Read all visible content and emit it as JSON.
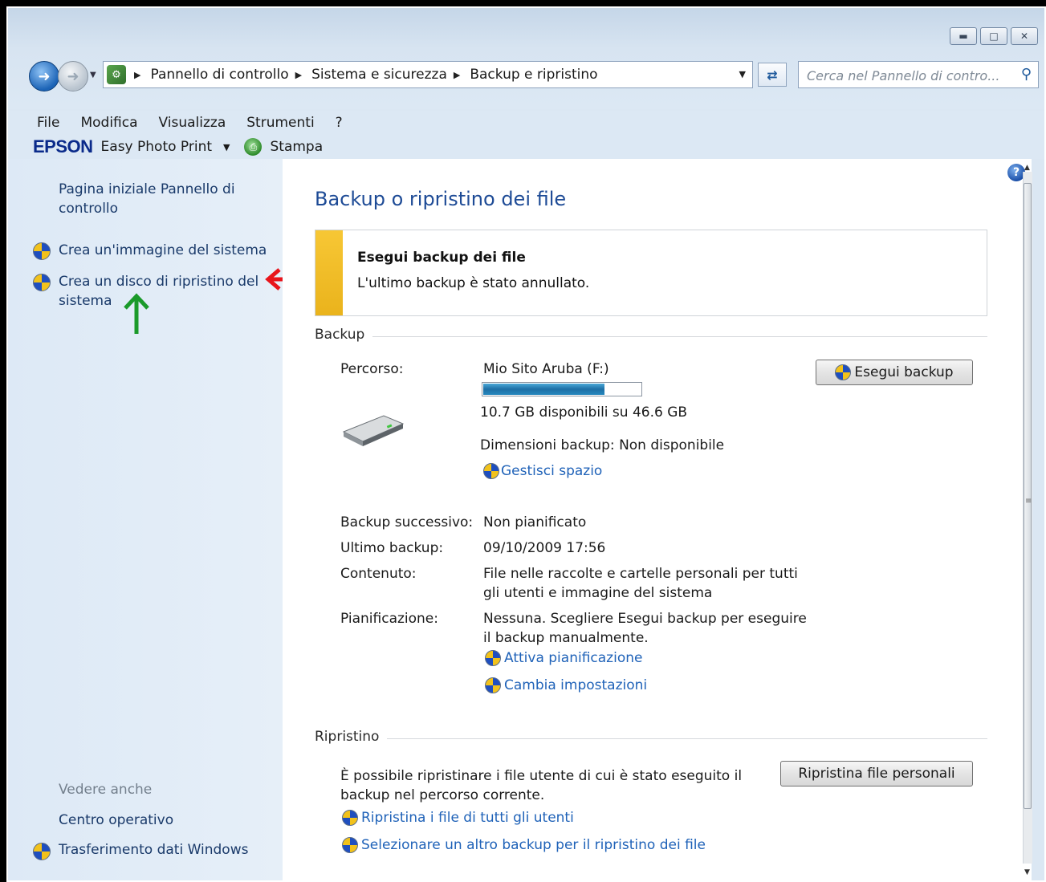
{
  "address": {
    "crumbs": [
      "Pannello di controllo",
      "Sistema e sicurezza",
      "Backup e ripristino"
    ],
    "search_placeholder": "Cerca nel Pannello di contro..."
  },
  "menu": [
    "File",
    "Modifica",
    "Visualizza",
    "Strumenti",
    "?"
  ],
  "toolbar": {
    "brand": "EPSON",
    "app": "Easy Photo Print",
    "print": "Stampa"
  },
  "left": {
    "home": "Pagina iniziale Pannello di controllo",
    "home_l1": "Pagina iniziale Pannello di",
    "home_l2": "controllo",
    "system_image": "Crea un'immagine del sistema",
    "repair_l1": "Crea un disco di ripristino del",
    "repair_l2": "sistema",
    "see_also": "Vedere anche",
    "action_center": "Centro operativo",
    "transfer": "Trasferimento dati Windows"
  },
  "main": {
    "title": "Backup o ripristino dei file",
    "notice_title": "Esegui backup dei file",
    "notice_text": "L'ultimo backup è stato annullato.",
    "backup_section": "Backup",
    "path_label": "Percorso:",
    "path_value": "Mio Sito  Aruba (F:)",
    "disk_used_fraction": 0.77,
    "disk_free": "10.7 GB disponibili su 46.6 GB",
    "backup_size": "Dimensioni backup: Non disponibile",
    "manage_space": "Gestisci spazio",
    "run_backup": "Esegui backup",
    "next_label": "Backup successivo:",
    "next_value": "Non pianificato",
    "last_label": "Ultimo backup:",
    "last_value": "09/10/2009 17:56",
    "contents_label": "Contenuto:",
    "contents_l1": "File nelle raccolte e cartelle personali per tutti",
    "contents_l2": "gli utenti e immagine del sistema",
    "schedule_label": "Pianificazione:",
    "schedule_l1": "Nessuna. Scegliere Esegui backup per eseguire",
    "schedule_l2": "il backup manualmente.",
    "enable_schedule": "Attiva pianificazione",
    "change_settings": "Cambia impostazioni",
    "restore_section": "Ripristino",
    "restore_l1": "È possibile ripristinare i file utente di cui è stato eseguito il",
    "restore_l2": "backup nel percorso corrente.",
    "restore_button": "Ripristina file personali",
    "restore_all": "Ripristina i file di tutti gli utenti",
    "select_other": "Selezionare un altro backup per il ripristino dei file"
  }
}
